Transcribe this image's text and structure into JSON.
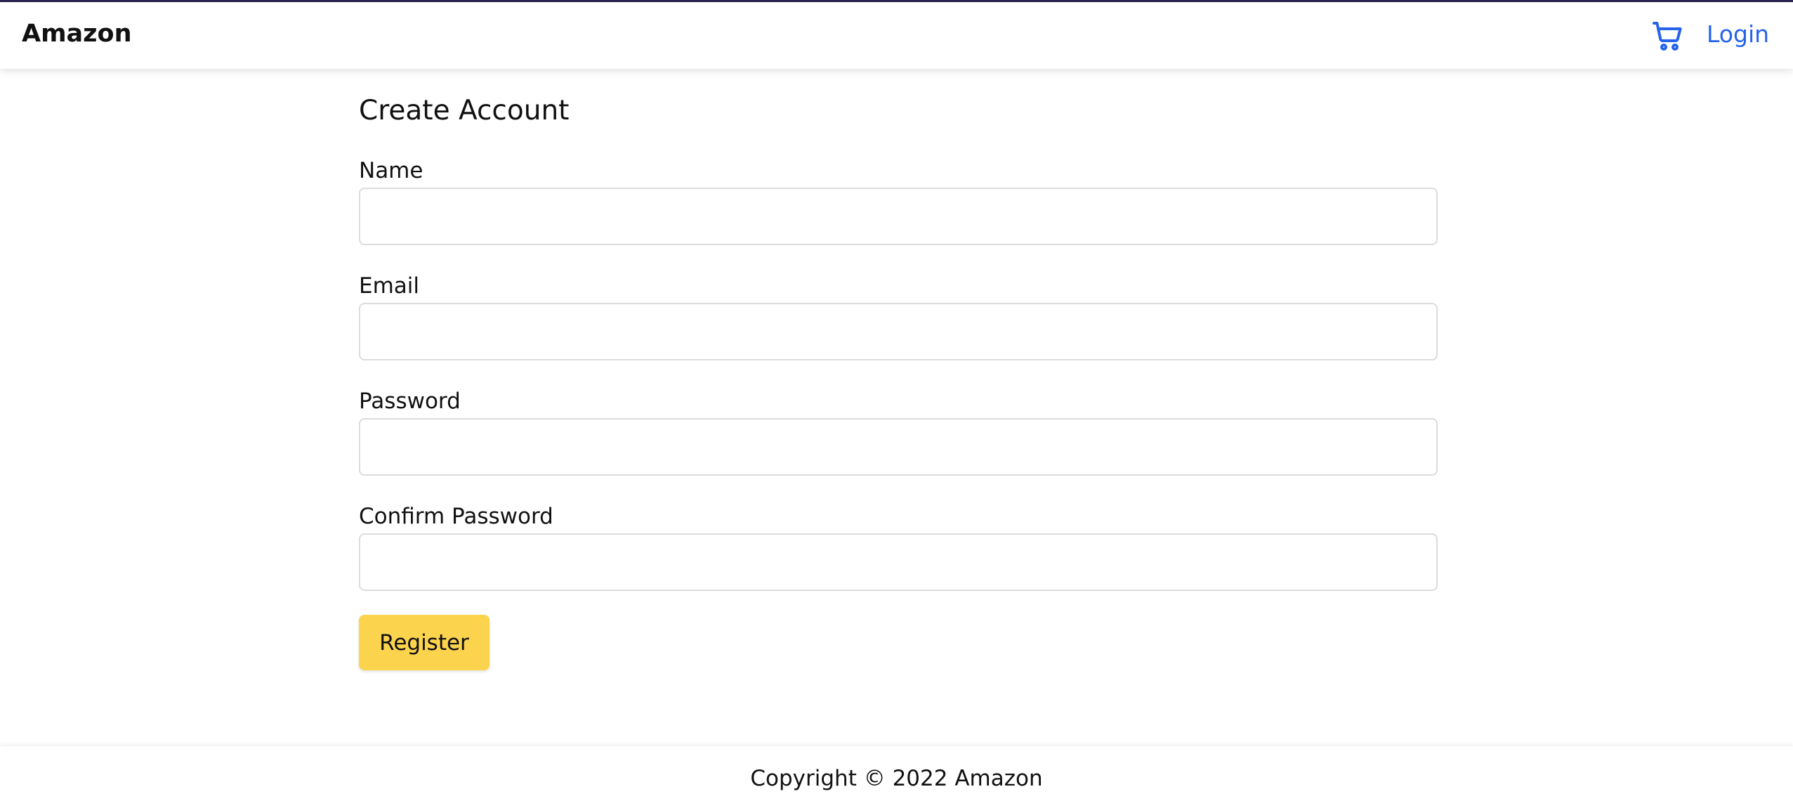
{
  "header": {
    "brand": "Amazon",
    "cart_icon": "shopping-cart-icon",
    "login_label": "Login"
  },
  "form": {
    "title": "Create Account",
    "fields": [
      {
        "label": "Name",
        "value": ""
      },
      {
        "label": "Email",
        "value": ""
      },
      {
        "label": "Password",
        "value": ""
      },
      {
        "label": "Confirm Password",
        "value": ""
      }
    ],
    "submit_label": "Register"
  },
  "footer": {
    "copyright": "Copyright © 2022 Amazon"
  },
  "colors": {
    "accent_top": "#2b2250",
    "link": "#2563eb",
    "button": "#fcd34d",
    "input_border": "#dcdcdc"
  }
}
